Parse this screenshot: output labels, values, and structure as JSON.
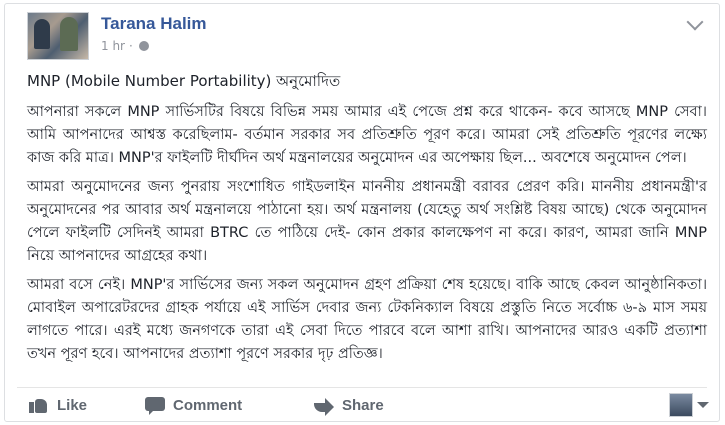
{
  "post": {
    "author": "Tarana Halim",
    "time": "1 hr",
    "separator": "·",
    "title": "MNP (Mobile Number Portability) অনুমোদিত",
    "paragraphs": [
      "আপনারা সকলে MNP সার্ভিসটির বিষয়ে বিভিন্ন সময় আমার এই পেজে প্রশ্ন করে থাকেন- কবে আসছে MNP সেবা। আমি আপনাদের আশ্বস্ত করেছিলাম- বর্তমান সরকার সব প্রতিশ্রুতি পূরণ করে। আমরা সেই প্রতিশ্রুতি পূরণের লক্ষ্যে কাজ করি মাত্র। MNP'র ফাইলটি দীর্ঘদিন অর্থ মন্ত্রনালয়ের অনুমোদন এর অপেক্ষায় ছিল... অবশেষে অনুমোদন পেল।",
      "আমরা অনুমোদনের জন্য পুনরায় সংশোধিত গাইডলাইন মাননীয় প্রধানমন্ত্রী বরাবর প্রেরণ করি। মাননীয় প্রধানমন্ত্রী'র অনুমোদনের পর আবার অর্থ মন্ত্রনালয়ে পাঠানো হয়। অর্থ মন্ত্রনালয় (যেহেতু অর্থ সংশ্লিষ্ট বিষয় আছে) থেকে অনুমোদন পেলে ফাইলটি সেদিনই আমরা BTRC তে পাঠিয়ে দেই- কোন প্রকার কালক্ষেপণ না করে। কারণ, আমরা জানি MNP নিয়ে আপনাদের আগ্রহের কথা।",
      "আমরা বসে নেই। MNP'র সার্ভিসের জন্য সকল অনুমোদন গ্রহণ প্রক্রিয়া শেষ হয়েছে। বাকি আছে কেবল আনুষ্ঠানিকতা। মোবাইল অপারেটরদের গ্রাহক পর্যায়ে এই সার্ভিস দেবার জন্য টেকনিক্যাল বিষয়ে প্রস্তুতি নিতে সর্বোচ্চ ৬-৯ মাস সময় লাগতে পারে। এরই মধ্যে জনগণকে তারা এই সেবা দিতে পারবে বলে আশা রাখি। আপনাদের আরও একটি প্রত্যাশা তখন পূরণ হবে। আপনাদের প্রত্যাশা পূরণে সরকার দৃঢ় প্রতিজ্ঞ।"
    ]
  },
  "actions": {
    "like": "Like",
    "comment": "Comment",
    "share": "Share"
  },
  "icons": {
    "avatar": "profile-photo",
    "privacy": "globe-icon",
    "options": "chevron-down-icon",
    "like": "thumbs-up-icon",
    "comment": "speech-bubble-icon",
    "share": "share-arrow-icon",
    "viewer": "viewer-avatar-icon"
  },
  "colors": {
    "author": "#365899",
    "meta": "#90949c",
    "action": "#606770",
    "text": "#1d2129"
  }
}
